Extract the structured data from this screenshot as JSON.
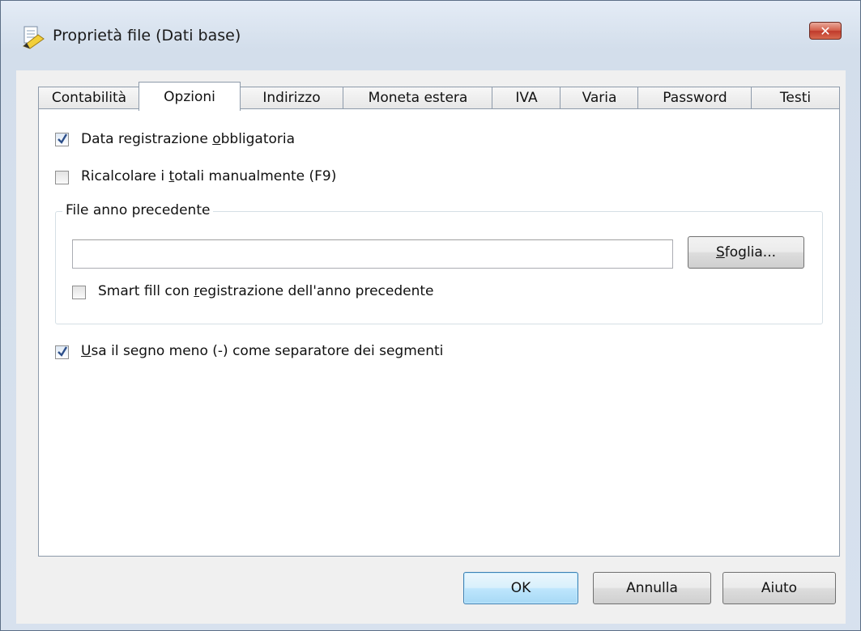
{
  "window": {
    "title": "Proprietà file (Dati base)",
    "close_glyph": "✕"
  },
  "tabs": [
    {
      "label": "Contabilità",
      "active": false
    },
    {
      "label": "Opzioni",
      "active": true
    },
    {
      "label": "Indirizzo",
      "active": false
    },
    {
      "label": "Moneta estera",
      "active": false
    },
    {
      "label": "IVA",
      "active": false
    },
    {
      "label": "Varia",
      "active": false
    },
    {
      "label": "Password",
      "active": false
    },
    {
      "label": "Testi",
      "active": false
    }
  ],
  "options": {
    "data_registrazione": {
      "pre": "Data registrazione ",
      "u": "o",
      "post": "bbligatoria",
      "checked": true
    },
    "ricalcolare": {
      "pre": "Ricalcolare i ",
      "u": "t",
      "post": "otali manualmente (F9)",
      "checked": false
    },
    "file_group": {
      "legend": "File anno precedente",
      "path_value": "",
      "browse": {
        "u": "S",
        "post": "foglia..."
      },
      "smart_fill": {
        "pre": "Smart fill con ",
        "u": "r",
        "post": "egistrazione dell'anno precedente",
        "checked": false
      }
    },
    "segno_meno": {
      "u": "U",
      "post": "sa il segno meno (-) come separatore dei segmenti",
      "checked": true
    }
  },
  "buttons": {
    "ok": "OK",
    "cancel": "Annulla",
    "help": "Aiuto"
  }
}
